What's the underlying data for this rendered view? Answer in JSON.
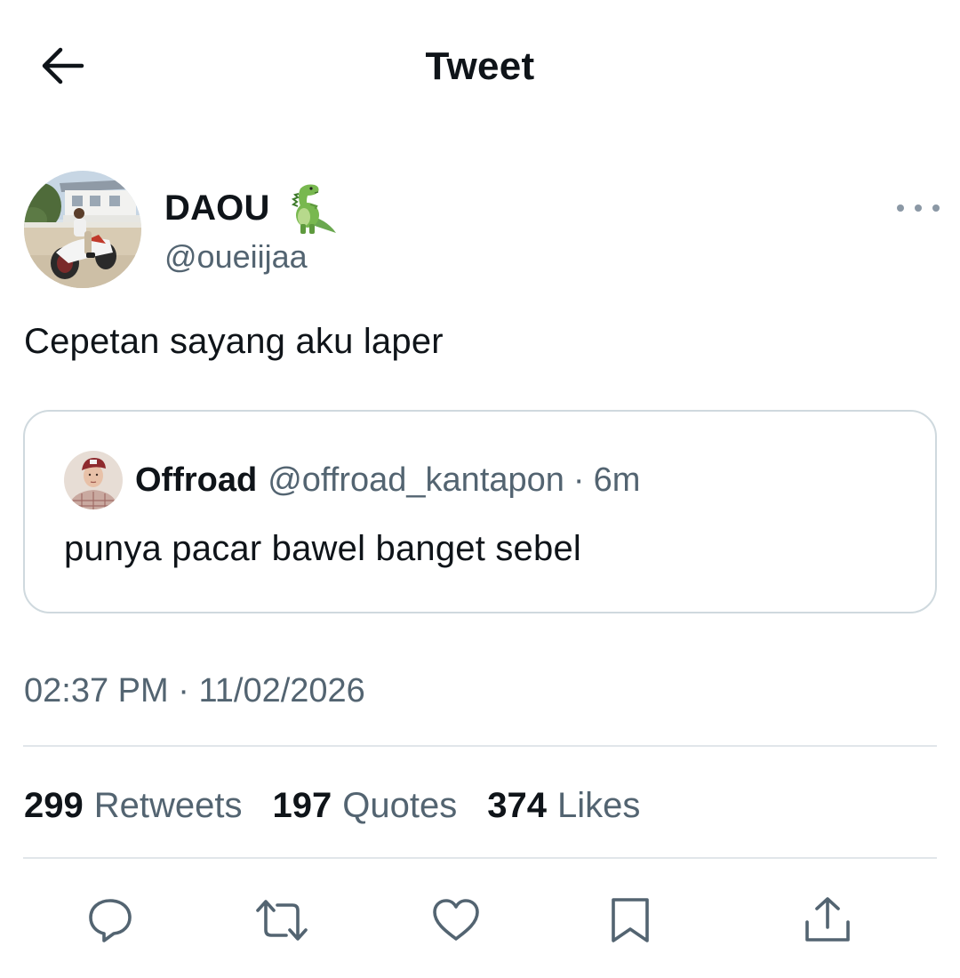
{
  "header": {
    "title": "Tweet",
    "back_icon": "arrow-left-icon"
  },
  "author": {
    "name": "DAOU",
    "emoji_icon": "t-rex-emoji-icon",
    "handle": "@oueiijaa"
  },
  "tweet": {
    "text": "Cepetan sayang aku laper"
  },
  "quote": {
    "name": "Offroad",
    "handle": "@offroad_kantapon",
    "separator": "·",
    "time": "6m",
    "text": "punya pacar bawel banget sebel"
  },
  "timestamp": {
    "time": "02:37 PM",
    "separator": "·",
    "date": "11/02/2026"
  },
  "stats": [
    {
      "count": "299",
      "label": "Retweets"
    },
    {
      "count": "197",
      "label": "Quotes"
    },
    {
      "count": "374",
      "label": "Likes"
    }
  ],
  "actions": [
    {
      "icon": "reply-icon"
    },
    {
      "icon": "retweet-icon"
    },
    {
      "icon": "like-icon"
    },
    {
      "icon": "bookmark-icon"
    },
    {
      "icon": "share-icon"
    }
  ],
  "colors": {
    "text_primary": "#0f1419",
    "text_secondary": "#536471",
    "border": "#cfd9de",
    "divider": "#e1e6ea",
    "icon": "#536471"
  }
}
